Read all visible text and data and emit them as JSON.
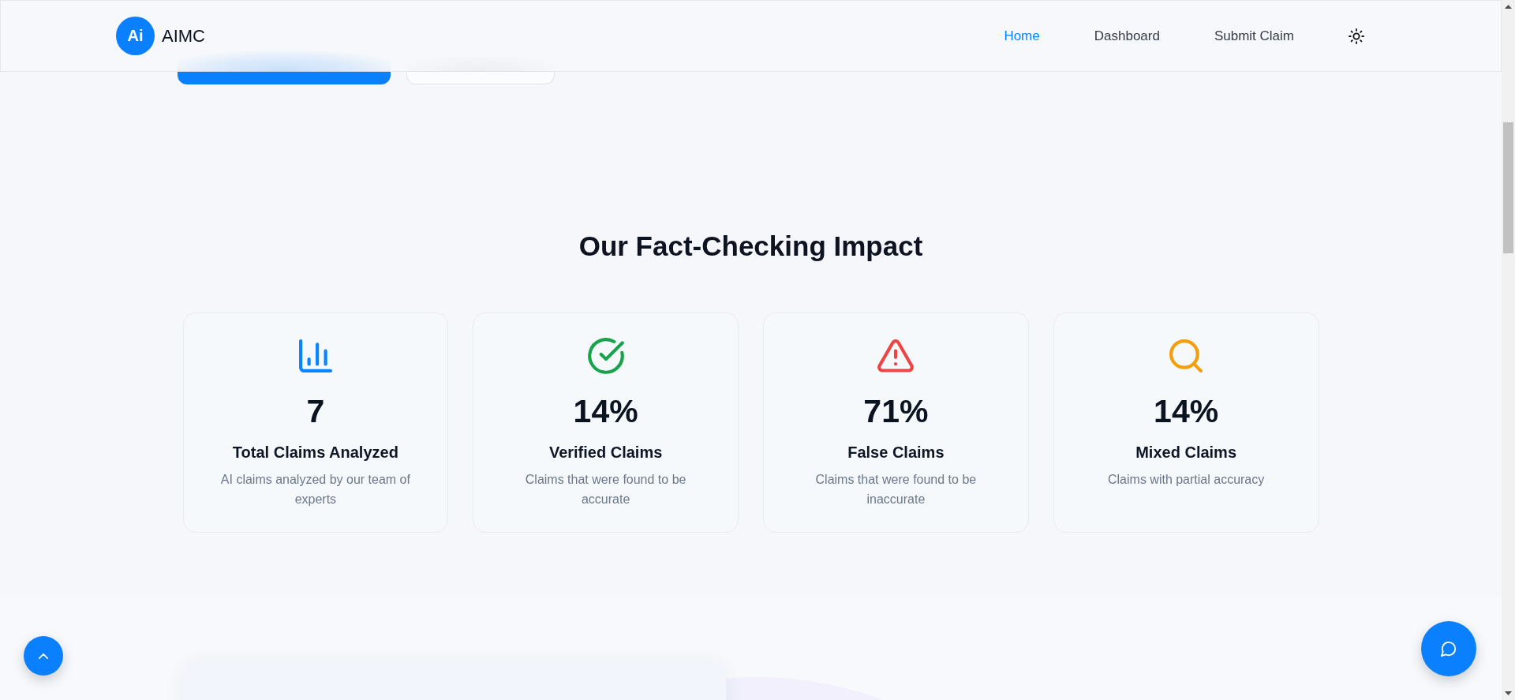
{
  "header": {
    "logo": {
      "mark": "Ai",
      "name": "AIMC"
    },
    "nav": [
      {
        "label": "Home",
        "selected": true
      },
      {
        "label": "Dashboard",
        "selected": false
      },
      {
        "label": "Submit Claim",
        "selected": false
      }
    ]
  },
  "hero": {
    "buttons": [
      {
        "kind": "primary"
      },
      {
        "kind": "outline"
      }
    ]
  },
  "impact": {
    "title": "Our Fact-Checking Impact",
    "stats": [
      {
        "kind": "chart",
        "color": "#0a84ff",
        "value": "7",
        "label": "Total Claims Analyzed",
        "description": "AI claims analyzed by our team of experts"
      },
      {
        "kind": "check",
        "color": "#16a34a",
        "value": "14%",
        "label": "Verified Claims",
        "description": "Claims that were found to be accurate"
      },
      {
        "kind": "warning",
        "color": "#ef4444",
        "value": "71%",
        "label": "False Claims",
        "description": "Claims that were found to be inaccurate"
      },
      {
        "kind": "search",
        "color": "#f59e0b",
        "value": "14%",
        "label": "Mixed Claims",
        "description": "Claims with partial accuracy"
      }
    ]
  }
}
